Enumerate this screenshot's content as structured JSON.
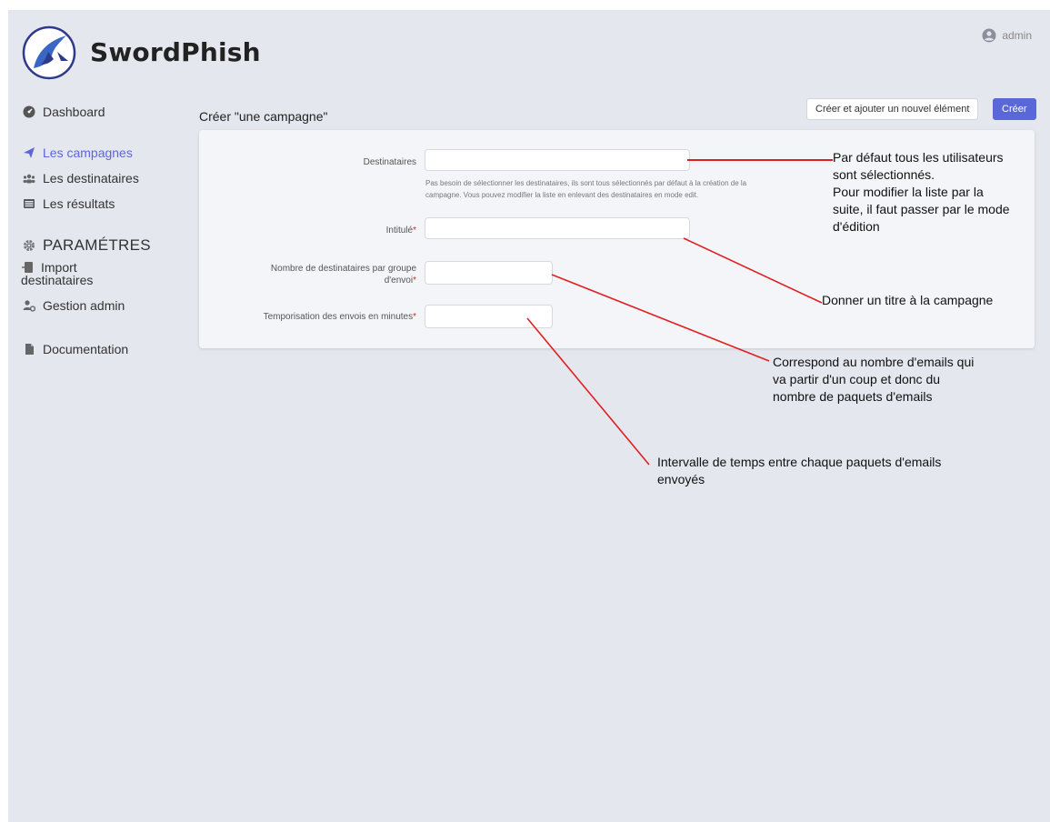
{
  "brand": {
    "name": "SwordPhish"
  },
  "user": {
    "name": "admin"
  },
  "sidebar": {
    "dashboard": "Dashboard",
    "campaigns": "Les campagnes",
    "recipients": "Les destinataires",
    "results": "Les résultats",
    "settings_section": "PARAMÉTRES",
    "import_line1": "Import",
    "import_line2": "destinataires",
    "admin_management": "Gestion admin",
    "documentation": "Documentation"
  },
  "page": {
    "title": "Créer \"une campagne\"",
    "btn_create_add": "Créer et ajouter un nouvel élément",
    "btn_create": "Créer"
  },
  "form": {
    "recipients_label": "Destinataires",
    "recipients_help_1": "Pas besoin de sélectionner les destinataires, ils sont tous sélectionnés par défaut à la création de la",
    "recipients_help_2": "campagne. Vous pouvez modifier la liste en enlevant des destinataires en mode edit.",
    "title_label": "Intitulé",
    "group_size_label_1": "Nombre de destinataires par groupe",
    "group_size_label_2": "d'envoi",
    "delay_label": "Temporisation des envois en minutes",
    "required_mark": "*"
  },
  "annotations": {
    "recipients": [
      "Par défaut tous les utilisateurs",
      "sont sélectionnés.",
      "Pour modifier la liste par la",
      "suite, il faut passer par le mode",
      "d'édition"
    ],
    "title": [
      "Donner un titre à la campagne"
    ],
    "group_size": [
      "Correspond au nombre d'emails qui",
      "va partir d'un coup et donc du",
      "nombre de paquets d'emails"
    ],
    "delay": [
      "Intervalle de temps entre chaque paquets d'emails",
      "envoyés"
    ]
  },
  "colors": {
    "accent": "#5a67d8",
    "annotation_line": "#e02020",
    "required": "#c53030",
    "background": "#e5e7ee"
  }
}
